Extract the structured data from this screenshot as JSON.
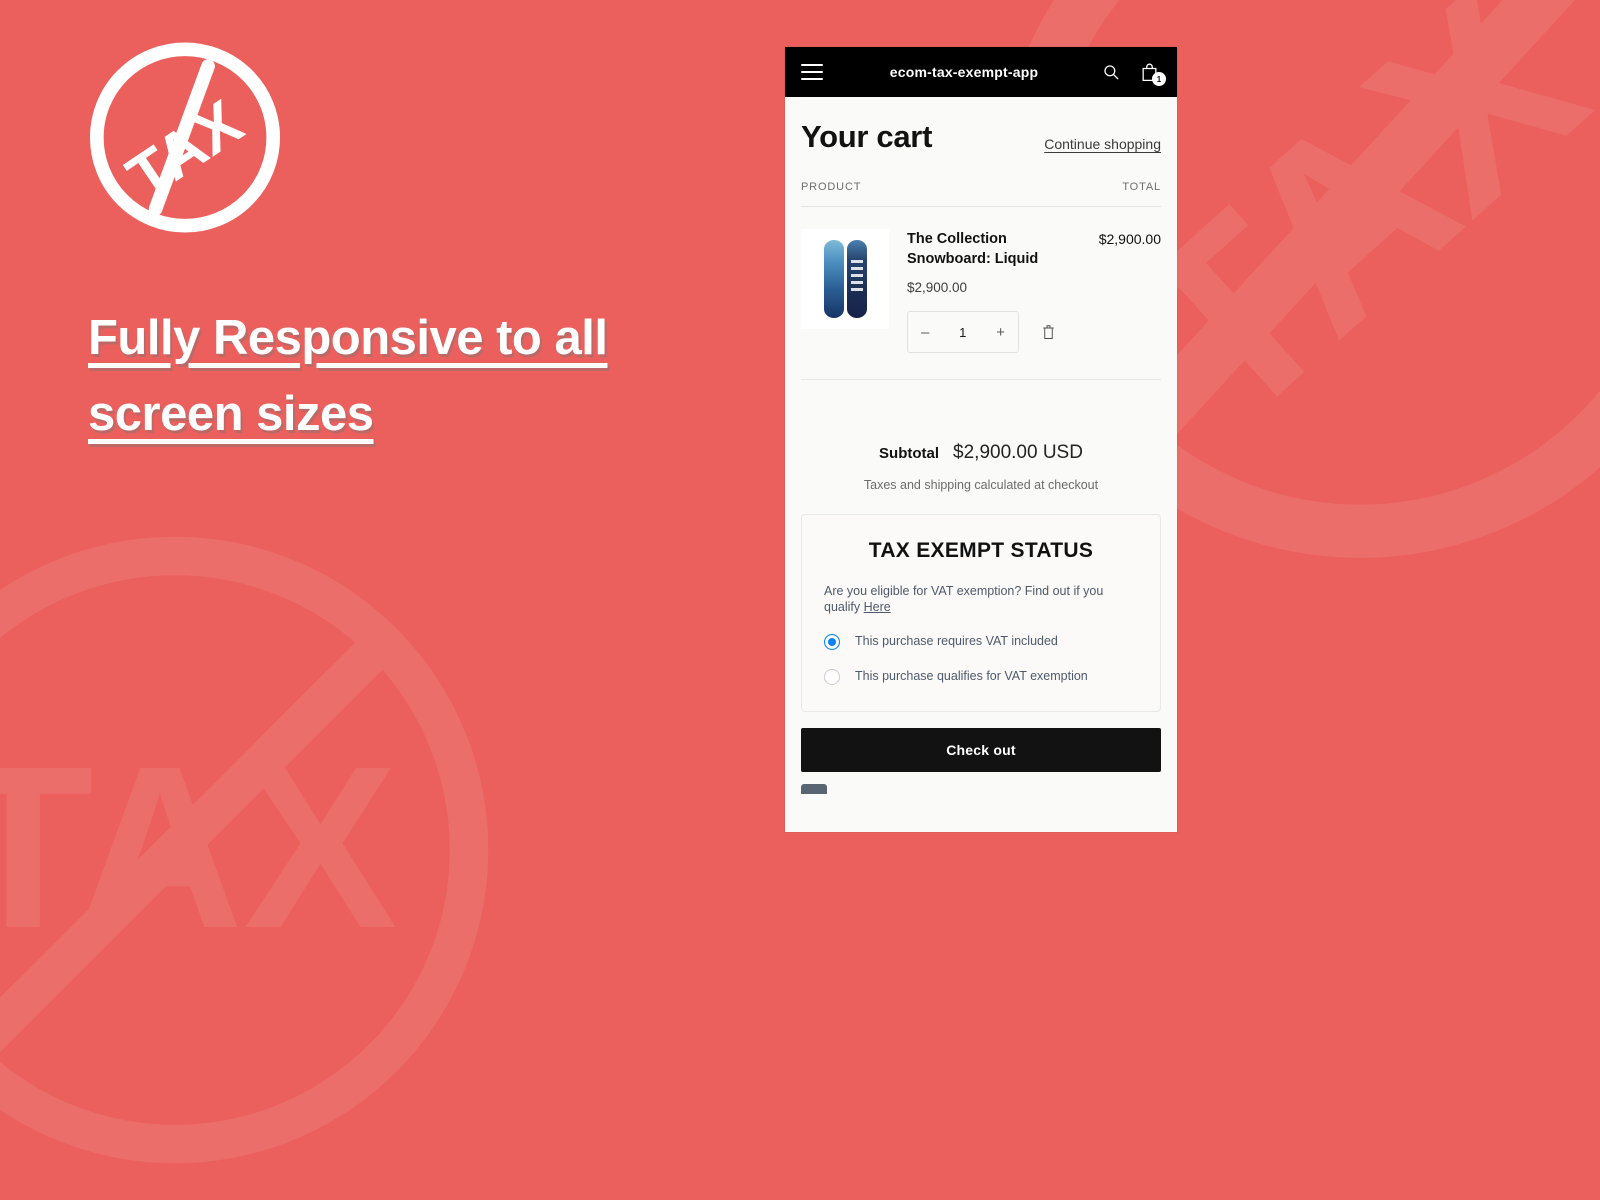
{
  "theme": {
    "background": "#eb5f5c",
    "panel_background": "#fafaf9",
    "app_bar_background": "#000000",
    "accent_radio": "#0b84f3",
    "checkout_button": "#121212"
  },
  "promo": {
    "logo_icon": "no-tax-circle-slash-icon",
    "logo_text": "TAX",
    "headline_line1": "Fully Responsive to all",
    "headline_line2": "screen sizes"
  },
  "watermarks": [
    {
      "name": "watermark-top-right",
      "icon": "no-tax-circle-slash-icon",
      "text": "TAX"
    },
    {
      "name": "watermark-bottom-left",
      "icon": "no-tax-circle-slash-icon",
      "text": "TAX"
    }
  ],
  "app": {
    "menu_icon": "hamburger-menu-icon",
    "title": "ecom-tax-exempt-app",
    "search_icon": "search-icon",
    "cart_icon": "shopping-bag-icon",
    "cart_count": "1"
  },
  "cart": {
    "title": "Your cart",
    "continue_link": "Continue shopping",
    "columns": {
      "product": "PRODUCT",
      "total": "TOTAL"
    },
    "items": [
      {
        "image_alt": "snowboard-product-image",
        "name": "The Collection Snowboard: Liquid",
        "unit_price": "$2,900.00",
        "quantity": "1",
        "decrease_label": "–",
        "increase_label": "+",
        "remove_icon": "trash-icon",
        "line_total": "$2,900.00"
      }
    ],
    "subtotal_label": "Subtotal",
    "subtotal_value": "$2,900.00 USD",
    "tax_note": "Taxes and shipping calculated at checkout",
    "checkout_label": "Check out"
  },
  "tax_exempt": {
    "title": "TAX EXEMPT STATUS",
    "description_before": "Are you eligible for VAT exemption? Find out if you qualify ",
    "description_link": "Here",
    "options": [
      {
        "label": "This purchase requires VAT included",
        "selected": true
      },
      {
        "label": "This purchase qualifies for VAT exemption",
        "selected": false
      }
    ]
  }
}
